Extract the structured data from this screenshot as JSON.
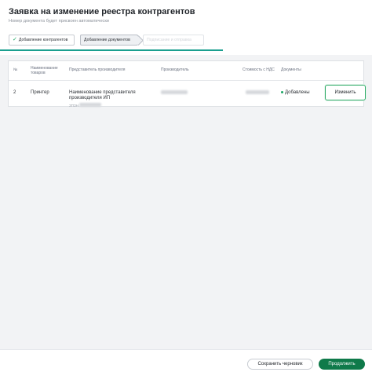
{
  "header": {
    "title": "Заявка на изменение реестра контрагентов",
    "subtitle": "Номер документа будет присвоен автоматически"
  },
  "stepper": {
    "steps": [
      {
        "label": "Добавление контрагентов",
        "state": "done"
      },
      {
        "label": "Добавление документов",
        "state": "active"
      },
      {
        "label": "Подписание и отправка",
        "state": "pending"
      }
    ]
  },
  "table": {
    "columns": [
      "№",
      "Наименование товаров",
      "Представитель производителя",
      "Производитель",
      "Стоимость с НДС",
      "Документы"
    ],
    "rows": [
      {
        "num": "2",
        "product": "Принтер",
        "representative": "Наименование представителя производителя ИП",
        "representative_sub": "ЗПЗН",
        "documents": "Добавлены",
        "edit_label": "Изменить"
      }
    ]
  },
  "footer": {
    "save_draft_label": "Сохранить черновик",
    "continue_label": "Продолжить"
  },
  "colors": {
    "accent": "#1a9f8f",
    "primary_button": "#0f7a4a",
    "success": "#1aa563"
  }
}
